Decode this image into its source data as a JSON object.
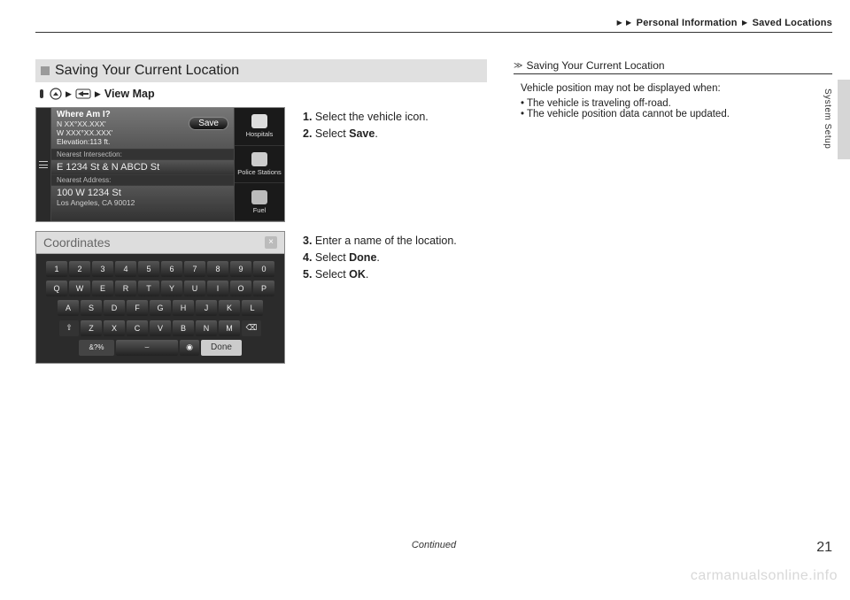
{
  "header": {
    "crumb1": "Personal Information",
    "crumb2": "Saved Locations"
  },
  "side_tab_label": "System Setup",
  "section_title": "Saving Your Current Location",
  "breadcrumb": {
    "view_map": "View Map"
  },
  "shot1": {
    "title": "Where Am I?",
    "coords_n": "N XX°XX.XXX'",
    "coords_w": "W XXX°XX.XXX'",
    "elevation": "Elevation:113 ft.",
    "save": "Save",
    "nearest_intersection_label": "Nearest Intersection:",
    "nearest_intersection": "E 1234 St & N ABCD St",
    "nearest_address_label": "Nearest Address:",
    "nearest_address_line1": "100 W 1234 St",
    "nearest_address_line2": "Los Angeles, CA 90012",
    "poi": {
      "hospitals": "Hospitals",
      "police": "Police Stations",
      "fuel": "Fuel"
    }
  },
  "steps_a": {
    "s1_num": "1.",
    "s1_text": "Select the vehicle icon.",
    "s2_num": "2.",
    "s2_text_pre": "Select ",
    "s2_bold": "Save",
    "s2_text_post": "."
  },
  "shot2": {
    "header": "Coordinates",
    "row1": [
      "1",
      "2",
      "3",
      "4",
      "5",
      "6",
      "7",
      "8",
      "9",
      "0"
    ],
    "row2": [
      "Q",
      "W",
      "E",
      "R",
      "T",
      "Y",
      "U",
      "I",
      "O",
      "P"
    ],
    "row3": [
      "A",
      "S",
      "D",
      "F",
      "G",
      "H",
      "J",
      "K",
      "L"
    ],
    "row4_shift": "⇧",
    "row4": [
      "Z",
      "X",
      "C",
      "V",
      "B",
      "N",
      "M"
    ],
    "row4_bksp": "⌫",
    "row5_alt": "&?%",
    "row5_space": "⌣",
    "row5_mic": "◉",
    "row5_done": "Done"
  },
  "steps_b": {
    "s3_num": "3.",
    "s3_text": "Enter a name of the location.",
    "s4_num": "4.",
    "s4_text_pre": "Select ",
    "s4_bold": "Done",
    "s4_text_post": ".",
    "s5_num": "5.",
    "s5_text_pre": "Select ",
    "s5_bold": "OK",
    "s5_text_post": "."
  },
  "tips": {
    "title": "Saving Your Current Location",
    "line1": "Vehicle position may not be displayed when:",
    "bullet1": "The vehicle is traveling off-road.",
    "bullet2": "The vehicle position data cannot be updated."
  },
  "footer": {
    "continued": "Continued",
    "page": "21"
  },
  "watermark": "carmanualsonline.info"
}
